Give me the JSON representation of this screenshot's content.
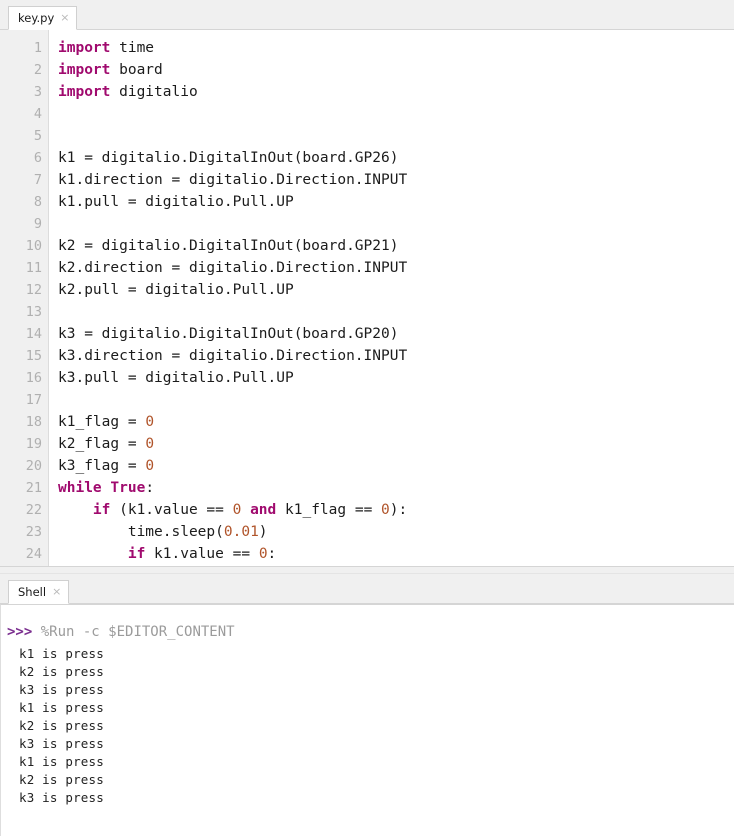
{
  "editor": {
    "tab": {
      "label": "key.py",
      "close": "×"
    },
    "lines": [
      {
        "n": "1",
        "tokens": [
          {
            "t": "import",
            "c": "kw"
          },
          {
            "t": " time",
            "c": ""
          }
        ]
      },
      {
        "n": "2",
        "tokens": [
          {
            "t": "import",
            "c": "kw"
          },
          {
            "t": " board",
            "c": ""
          }
        ]
      },
      {
        "n": "3",
        "tokens": [
          {
            "t": "import",
            "c": "kw"
          },
          {
            "t": " digitalio",
            "c": ""
          }
        ]
      },
      {
        "n": "4",
        "tokens": []
      },
      {
        "n": "5",
        "tokens": []
      },
      {
        "n": "6",
        "tokens": [
          {
            "t": "k1 = digitalio.DigitalInOut(board.GP26)",
            "c": ""
          }
        ]
      },
      {
        "n": "7",
        "tokens": [
          {
            "t": "k1.direction = digitalio.Direction.INPUT",
            "c": ""
          }
        ]
      },
      {
        "n": "8",
        "tokens": [
          {
            "t": "k1.pull = digitalio.Pull.UP",
            "c": ""
          }
        ]
      },
      {
        "n": "9",
        "tokens": []
      },
      {
        "n": "10",
        "tokens": [
          {
            "t": "k2 = digitalio.DigitalInOut(board.GP21)",
            "c": ""
          }
        ]
      },
      {
        "n": "11",
        "tokens": [
          {
            "t": "k2.direction = digitalio.Direction.INPUT",
            "c": ""
          }
        ]
      },
      {
        "n": "12",
        "tokens": [
          {
            "t": "k2.pull = digitalio.Pull.UP",
            "c": ""
          }
        ]
      },
      {
        "n": "13",
        "tokens": []
      },
      {
        "n": "14",
        "tokens": [
          {
            "t": "k3 = digitalio.DigitalInOut(board.GP20)",
            "c": ""
          }
        ]
      },
      {
        "n": "15",
        "tokens": [
          {
            "t": "k3.direction = digitalio.Direction.INPUT",
            "c": ""
          }
        ]
      },
      {
        "n": "16",
        "tokens": [
          {
            "t": "k3.pull = digitalio.Pull.UP",
            "c": ""
          }
        ]
      },
      {
        "n": "17",
        "tokens": []
      },
      {
        "n": "18",
        "tokens": [
          {
            "t": "k1_flag = ",
            "c": ""
          },
          {
            "t": "0",
            "c": "num"
          }
        ]
      },
      {
        "n": "19",
        "tokens": [
          {
            "t": "k2_flag = ",
            "c": ""
          },
          {
            "t": "0",
            "c": "num"
          }
        ]
      },
      {
        "n": "20",
        "tokens": [
          {
            "t": "k3_flag = ",
            "c": ""
          },
          {
            "t": "0",
            "c": "num"
          }
        ]
      },
      {
        "n": "21",
        "tokens": [
          {
            "t": "while",
            "c": "kw"
          },
          {
            "t": " ",
            "c": ""
          },
          {
            "t": "True",
            "c": "kw"
          },
          {
            "t": ":",
            "c": ""
          }
        ]
      },
      {
        "n": "22",
        "tokens": [
          {
            "t": "    ",
            "c": ""
          },
          {
            "t": "if",
            "c": "kw"
          },
          {
            "t": " (k1.value == ",
            "c": ""
          },
          {
            "t": "0",
            "c": "num"
          },
          {
            "t": " ",
            "c": ""
          },
          {
            "t": "and",
            "c": "kw"
          },
          {
            "t": " k1_flag == ",
            "c": ""
          },
          {
            "t": "0",
            "c": "num"
          },
          {
            "t": "):",
            "c": ""
          }
        ]
      },
      {
        "n": "23",
        "tokens": [
          {
            "t": "        time.sleep(",
            "c": ""
          },
          {
            "t": "0.01",
            "c": "num"
          },
          {
            "t": ")",
            "c": ""
          }
        ]
      },
      {
        "n": "24",
        "tokens": [
          {
            "t": "        ",
            "c": ""
          },
          {
            "t": "if",
            "c": "kw"
          },
          {
            "t": " k1.value == ",
            "c": ""
          },
          {
            "t": "0",
            "c": "num"
          },
          {
            "t": ":",
            "c": ""
          }
        ]
      }
    ]
  },
  "shell": {
    "tab": {
      "label": "Shell",
      "close": "×"
    },
    "prompt": ">>>",
    "command": "%Run -c $EDITOR_CONTENT",
    "output": [
      "k1 is press",
      "k2 is press",
      "k3 is press",
      "k1 is press",
      "k2 is press",
      "k3 is press",
      "k1 is press",
      "k2 is press",
      "k3 is press"
    ]
  },
  "colors": {
    "keyword": "#a00a6e",
    "number": "#b0542a",
    "prompt": "#7b2f8f",
    "command": "#9b9b9b",
    "chrome": "#f0f0f0"
  }
}
